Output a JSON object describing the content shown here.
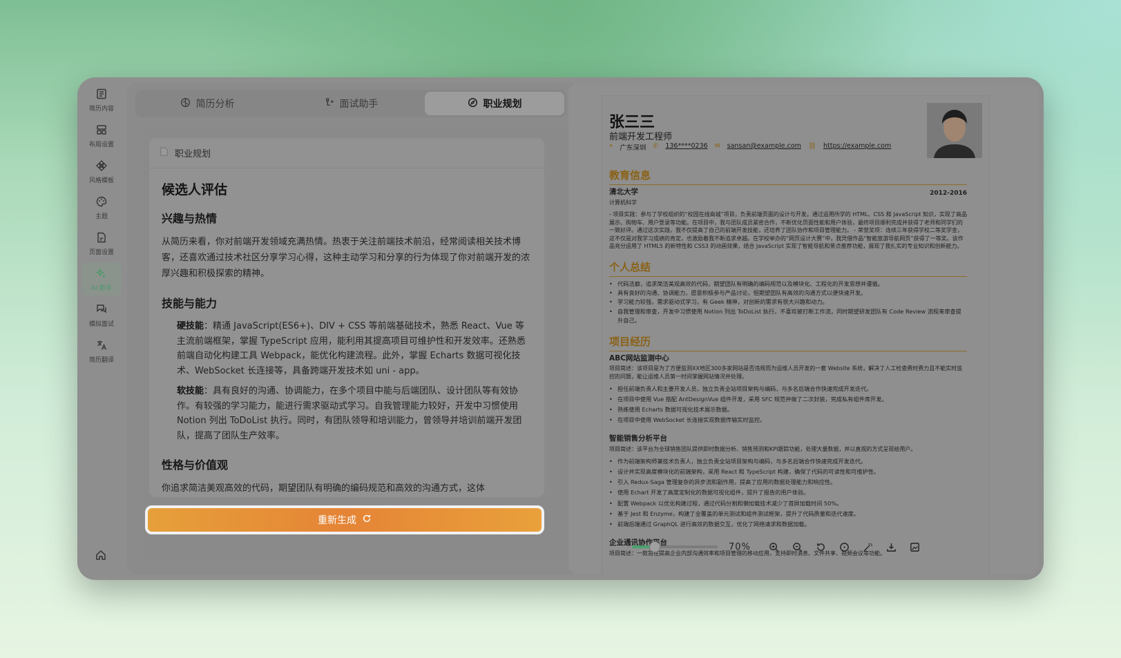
{
  "sidebar": {
    "items": [
      {
        "label": "简历内容",
        "icon": "document-list-icon"
      },
      {
        "label": "布局设置",
        "icon": "layout-icon"
      },
      {
        "label": "风格模板",
        "icon": "template-icon"
      },
      {
        "label": "主题",
        "icon": "palette-icon"
      },
      {
        "label": "页面设置",
        "icon": "page-icon"
      },
      {
        "label": "AI 助手",
        "icon": "ai-sparkle-icon",
        "active": true
      },
      {
        "label": "模拟面试",
        "icon": "chat-icon"
      },
      {
        "label": "简历翻译",
        "icon": "translate-icon"
      }
    ],
    "home_icon": "home-icon"
  },
  "tabs": [
    {
      "label": "简历分析"
    },
    {
      "label": "面试助手"
    },
    {
      "label": "职业规划",
      "active": true
    }
  ],
  "card": {
    "title": "职业规划",
    "heading": "候选人评估",
    "s1_title": "兴趣与热情",
    "s1_text": "从简历来看，你对前端开发领域充满热情。热衷于关注前端技术前沿，经常阅读相关技术博客，还喜欢通过技术社区分享学习心得，这种主动学习和分享的行为体现了你对前端开发的浓厚兴趣和积极探索的精神。",
    "s2_title": "技能与能力",
    "hard_label": "硬技能",
    "hard_text": "：精通 JavaScript(ES6+)、DIV + CSS 等前端基础技术，熟悉 React、Vue 等主流前端框架，掌握 TypeScript 应用，能利用其提高项目可维护性和开发效率。还熟悉前端自动化构建工具 Webpack，能优化构建流程。此外，掌握 Echarts 数据可视化技术、WebSocket 长连接等，具备跨端开发技术如 uni - app。",
    "soft_label": "软技能",
    "soft_text": "：具有良好的沟通、协调能力，在多个项目中能与后端团队、设计团队等有效协作。有较强的学习能力，能进行需求驱动式学习。自我管理能力较好，开发中习惯使用 Notion 列出 ToDoList 执行。同时，有团队领导和培训能力，曾领导并培训前端开发团队，提高了团队生产效率。",
    "s3_title": "性格与价值观",
    "s3_text": "你追求简洁美观高效的代码，期望团队有明确的编码规范和高效的沟通方式，这体"
  },
  "regen_label": "重新生成",
  "resume": {
    "name": "张三三",
    "title": "前端开发工程师",
    "location": "广东深圳",
    "phone": "136****0236",
    "email": "sansan@example.com",
    "site": "https://example.com",
    "edu_title": "教育信息",
    "school": "清北大学",
    "major": "计算机科学",
    "edu_years": "2012-2016",
    "edu_text": "- 项目实践：参与了学校组织的“校园在线商城”项目，负责前端页面的设计与开发。通过运用所学的 HTML、CSS 和 JavaScript 知识，实现了商品展示、购物车、用户登录等功能。在项目中，我与团队成员紧密合作，不断优化页面性能和用户体验，最终项目顺利完成并获得了老师和同学们的一致好评。通过这次实践，我不仅提高了自己的前端开发技能，还培养了团队协作和项目管理能力。 - 荣誉奖项：连续三年获得学校二等奖学金，这不仅是对我学习成绩的肯定，也激励着我不断追求卓越。在学校举办的“网页设计大赛”中，我凭借作品“智能旅游导航网页”获得了一等奖。该作品充分运用了 HTML5 的新特性和 CSS3 的动画效果，结合 JavaScript 实现了智能导航和景点推荐功能，展现了我扎实的专业知识和创新能力。",
    "summary_title": "个人总结",
    "summary": [
      "代码洁癖，追求简洁美观高效的代码，期望团队有明确的编码规范以及模块化、工程化的开发思想并遵循。",
      "具有良好的沟通、协调能力，愿意积极参与产品讨论，但期望团队有高效的沟通方式以便快速开发。",
      "学习能力较强，需求驱动式学习，有 Geek 精神，对创新的需求有很大兴趣和动力。",
      "自我管理和审查，开发中习惯使用 Notion 列出 ToDoList 执行，不喜欢被打断工作流，同时期望研发团队有 Code Review 流程来审查提升自己。"
    ],
    "exp_title": "项目经历",
    "p1_name": "ABC网站监测中心",
    "p1_desc": "项目简述：该项目是为了方便监测XX地区300多家网站是否违规而为运维人员开发的一套 Website 系统，解决了人工检查费时费力且不能实时监控的问题，能让运维人员第一时间掌握网站情况并处理。",
    "p1_items": [
      "担任前端负责人和主要开发人员，独立负责全站项目架构与编码，与多名后端合作快速完成开发迭代。",
      "在项目中使用 Vue 搭配 AntDesignVue 组件开发，采用 SFC 规范并做了二次封装，完成私有组件库开发。",
      "熟练使用 Echarts 数据可视化技术展示数据。",
      "在项目中使用 WebSocket 长连接实现数据传输实时监控。"
    ],
    "p2_name": "智能销售分析平台",
    "p2_desc": "项目简述：该平台为全球销售团队提供即时数据分析、销售预测和KPI跟踪功能，处理大量数据，并以直观的方式呈现给用户。",
    "p2_items": [
      "作为前端架构师兼技术负责人，独立负责全站项目架构与编码，与多名后端合作快速完成开发迭代。",
      "设计并实现高度模块化的前端架构，采用 React 和 TypeScript 构建，确保了代码的可读性和可维护性。",
      "引入 Redux-Saga 管理复杂的异步流和副作用，提高了应用的数据处理能力和响应性。",
      "使用 Echart 开发了高度定制化的数据可视化组件，提升了报告的用户体验。",
      "配置 Webpack 以优化构建过程，通过代码分割和懒加载技术减少了首屏加载时间 50%。",
      "基于 Jest 和 Enzyme，构建了全覆盖的单元测试和组件测试框架，提升了代码质量和迭代速度。",
      "前端后端通过 GraphQL 进行高效的数据交互，优化了网络请求和数据加载。"
    ],
    "p3_name": "企业通讯协作平台",
    "p3_desc": "项目简述：一款旨在提高企业内部沟通效率和项目管理的移动应用，支持即时消息、文件共享、视频会议等功能。"
  },
  "zoom": {
    "percent": "70%",
    "level": 0.27,
    "icons": [
      "zoom-in-icon",
      "zoom-out-icon",
      "rotate-icon",
      "reset-icon",
      "magic-wand-icon",
      "download-icon",
      "image-export-icon"
    ]
  },
  "colors": {
    "accent": "#e58436",
    "section": "#8a6216",
    "active_green": "#4a9a6a"
  }
}
